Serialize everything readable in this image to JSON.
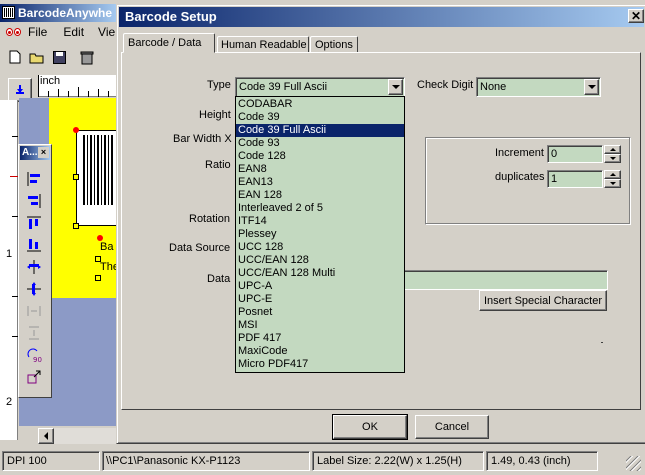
{
  "main_window": {
    "title": "BarcodeAnywhe",
    "menu": [
      "File",
      "Edit",
      "Vie"
    ],
    "ruler_unit": "inch",
    "ruler_marks": [
      "1",
      "2"
    ],
    "canvas_labels": [
      "Ba",
      "The"
    ],
    "mini_toolbar_title": "A..."
  },
  "dialog": {
    "title": "Barcode Setup",
    "tabs": [
      "Barcode / Data",
      "Human Readable",
      "Options"
    ],
    "labels": {
      "type": "Type",
      "height": "Height",
      "bar_width": "Bar Width X",
      "ratio": "Ratio",
      "rotation": "Rotation",
      "data_source": "Data Source",
      "data": "Data",
      "check_digit": "Check Digit",
      "increment": "Increment",
      "duplicates": "duplicates"
    },
    "type_value": "Code 39 Full Ascii",
    "check_digit_value": "None",
    "increment_value": "0",
    "duplicates_value": "1",
    "data_value": "",
    "insert_special_label": "Insert Special Character",
    "ok_label": "OK",
    "cancel_label": "Cancel",
    "type_options": [
      "CODABAR",
      "Code 39",
      "Code 39 Full Ascii",
      "Code 93",
      "Code 128",
      "EAN8",
      "EAN13",
      "EAN 128",
      "Interleaved 2 of 5",
      "ITF14",
      "Plessey",
      "UCC 128",
      "UCC/EAN 128",
      "UCC/EAN 128 Multi",
      "UPC-A",
      "UPC-E",
      "Posnet",
      "MSI",
      "PDF 417",
      "MaxiCode",
      "Micro PDF417"
    ],
    "selected_index": 2
  },
  "status_bar": {
    "dpi": "DPI 100",
    "printer": "\\\\PC1\\Panasonic KX-P1123",
    "label_size": "Label Size:  2.22(W) x 1.25(H)",
    "coords": "1.49, 0.43   (inch)"
  },
  "colors": {
    "title_start": "#0a246a",
    "title_end": "#a6caf0",
    "field_green": "#c3d9c0",
    "canvas_yellow": "#ffff00",
    "workspace_blue": "#8c9ac6",
    "selection": "#0a246a"
  }
}
